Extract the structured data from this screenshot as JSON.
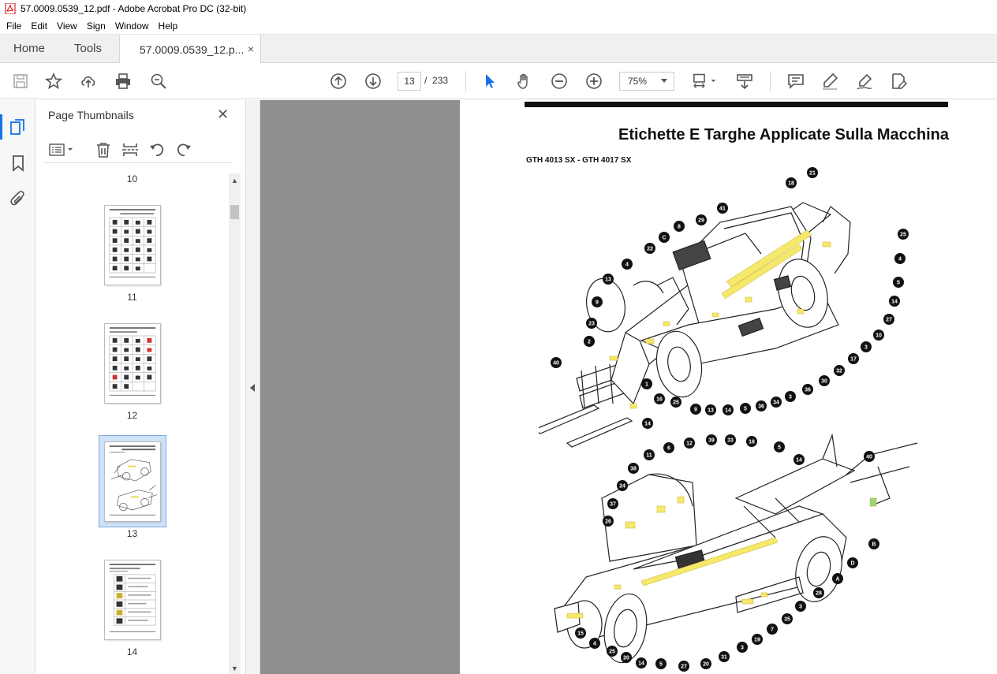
{
  "window": {
    "title": "57.0009.0539_12.pdf - Adobe Acrobat Pro DC (32-bit)"
  },
  "menu": [
    "File",
    "Edit",
    "View",
    "Sign",
    "Window",
    "Help"
  ],
  "tabs": {
    "home": "Home",
    "tools": "Tools",
    "document": "57.0009.0539_12.p...",
    "close": "×"
  },
  "toolbar": {
    "icons": [
      "save-icon",
      "star-icon",
      "upload-icon",
      "print-icon",
      "zoom-search-icon",
      "page-up-icon",
      "page-down-icon",
      "select-arrow-icon",
      "hand-icon",
      "zoom-out-icon",
      "zoom-in-icon",
      "page-fit-icon",
      "scroll-mode-icon",
      "comment-icon",
      "highlight-pen-icon",
      "sign-icon",
      "edit-doc-icon"
    ],
    "page_current": "13",
    "page_separator": "/",
    "page_total": "233",
    "zoom": "75%"
  },
  "panel": {
    "title": "Page Thumbnails",
    "close": "✕",
    "thumbnails": [
      {
        "label": "10"
      },
      {
        "label": "11"
      },
      {
        "label": "12"
      },
      {
        "label": "13",
        "selected": true
      },
      {
        "label": "14"
      }
    ]
  },
  "page": {
    "heading": "Etichette E Targhe Applicate Sulla Macchina",
    "subheading": "GTH 4013 SX - GTH 4017 SX",
    "callouts_top": [
      "21",
      "18",
      "25",
      "4",
      "5",
      "14",
      "27",
      "10",
      "3",
      "17",
      "32",
      "30",
      "36",
      "3",
      "34",
      "36",
      "5",
      "14",
      "13",
      "9",
      "25",
      "16",
      "1",
      "14",
      "40",
      "2",
      "23",
      "9",
      "13",
      "4",
      "22",
      "C",
      "8",
      "29",
      "41"
    ],
    "callouts_bottom": [
      "11",
      "6",
      "12",
      "39",
      "33",
      "18",
      "5",
      "14",
      "40",
      "38",
      "24",
      "37",
      "26",
      "B",
      "D",
      "A",
      "28",
      "3",
      "35",
      "7",
      "19",
      "3",
      "31",
      "20",
      "27",
      "5",
      "14",
      "20",
      "25",
      "4",
      "15"
    ]
  },
  "colors": {
    "accent": "#1473e6",
    "sticker": "#f5e86a",
    "viewer_bg": "#8f8f8f"
  }
}
